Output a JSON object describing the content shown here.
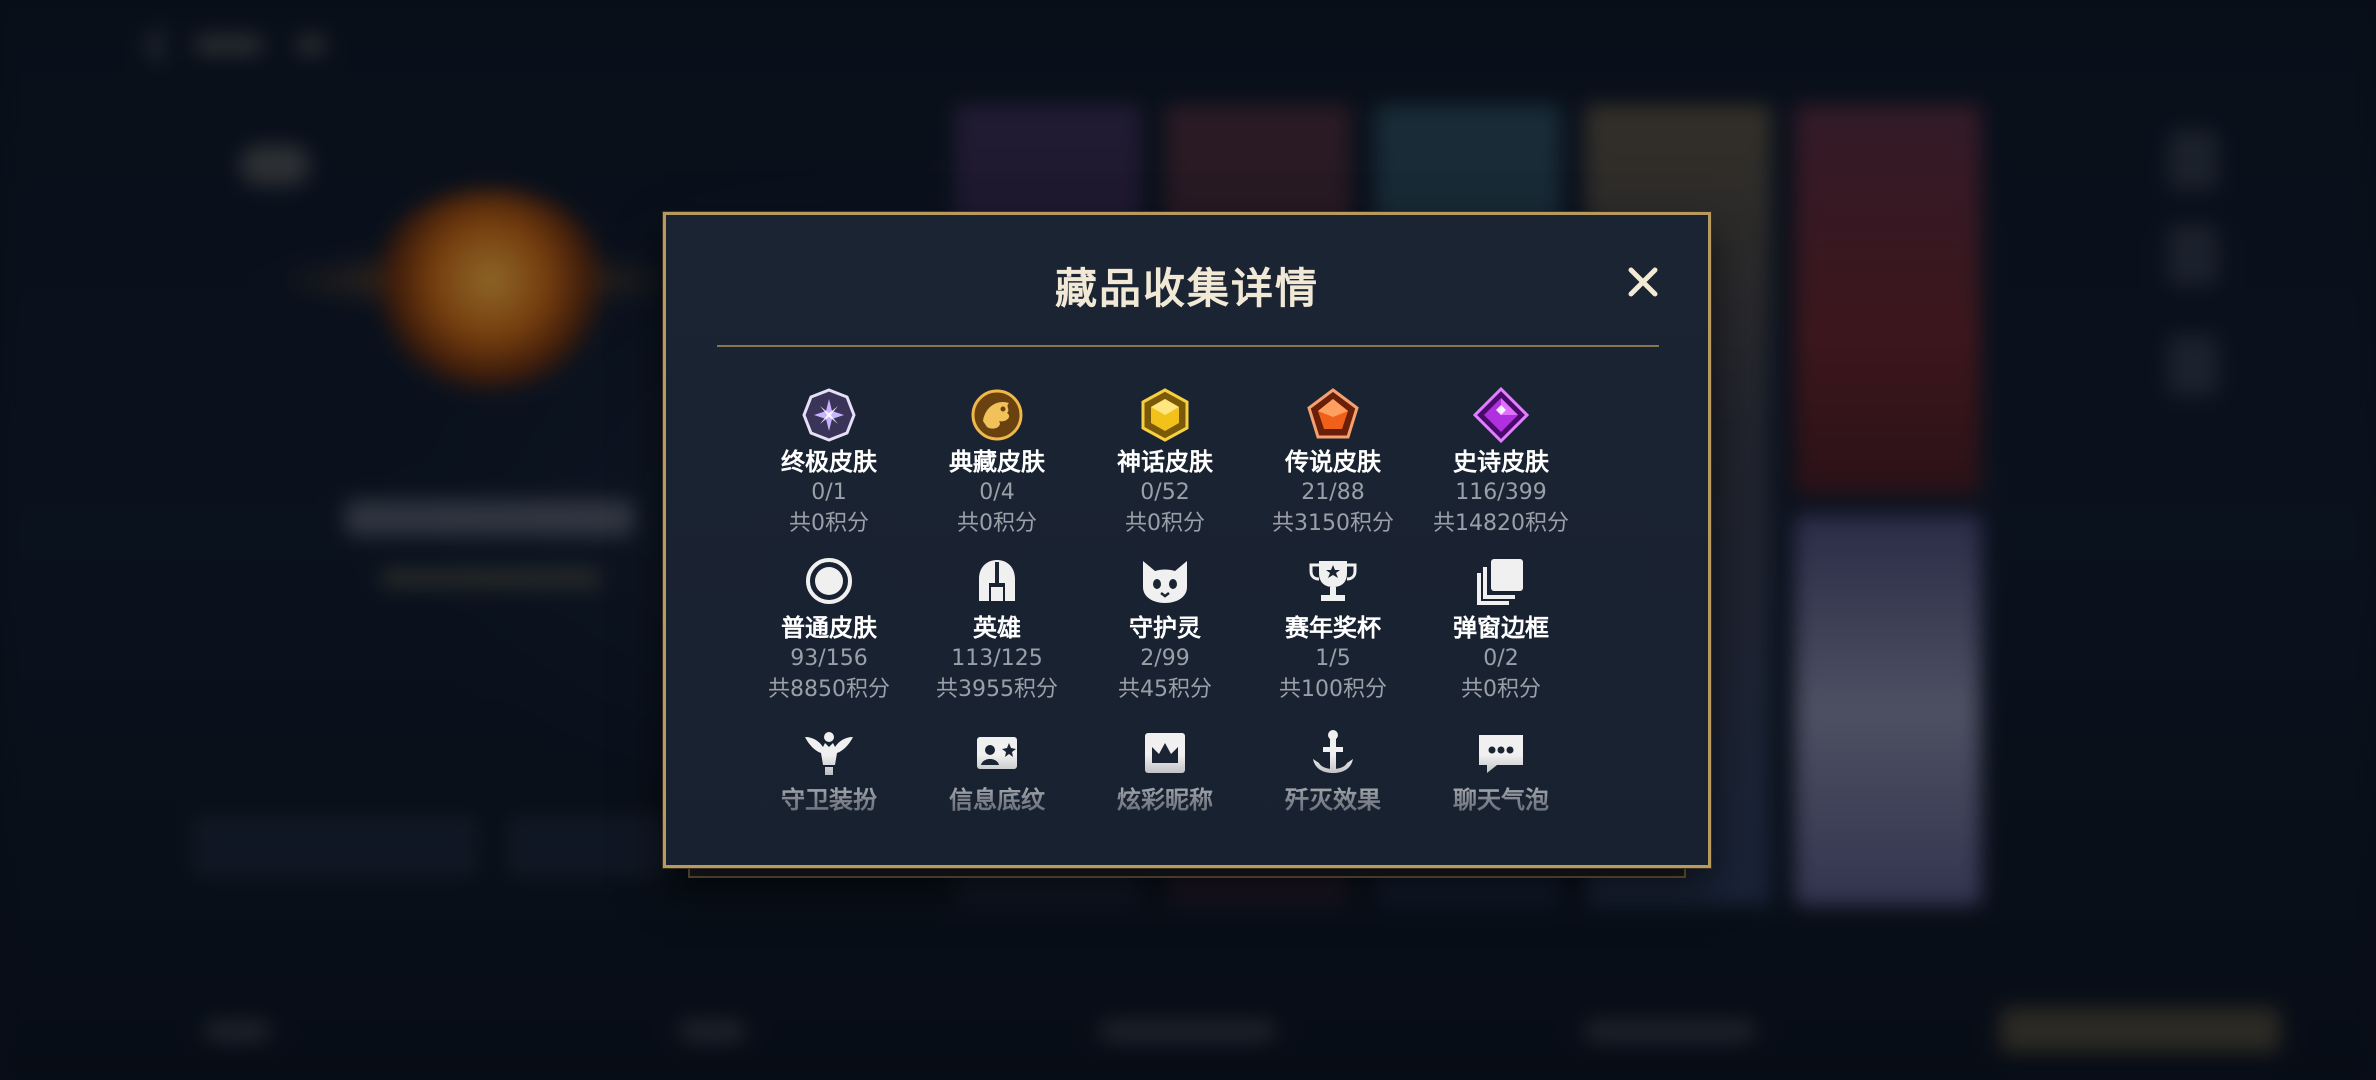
{
  "modal": {
    "title": "藏品收集详情",
    "close_icon": "close-icon"
  },
  "categories": [
    {
      "name": "终极皮肤",
      "count": "0/1",
      "points": "共0积分",
      "icon": "ultimate-skin-icon",
      "color": "#c9b3ff"
    },
    {
      "name": "典藏皮肤",
      "count": "0/4",
      "points": "共0积分",
      "icon": "collection-skin-icon",
      "color": "#e0a430"
    },
    {
      "name": "神话皮肤",
      "count": "0/52",
      "points": "共0积分",
      "icon": "mythic-skin-icon",
      "color": "#f2c21a"
    },
    {
      "name": "传说皮肤",
      "count": "21/88",
      "points": "共3150积分",
      "icon": "legend-skin-icon",
      "color": "#f0601a"
    },
    {
      "name": "史诗皮肤",
      "count": "116/399",
      "points": "共14820积分",
      "icon": "epic-skin-icon",
      "color": "#b030e0"
    },
    {
      "name": "普通皮肤",
      "count": "93/156",
      "points": "共8850积分",
      "icon": "normal-skin-icon",
      "color": "#e8e8e8"
    },
    {
      "name": "英雄",
      "count": "113/125",
      "points": "共3955积分",
      "icon": "hero-helmet-icon",
      "color": "#e8e8e8"
    },
    {
      "name": "守护灵",
      "count": "2/99",
      "points": "共45积分",
      "icon": "guardian-spirit-icon",
      "color": "#e8e8e8"
    },
    {
      "name": "赛年奖杯",
      "count": "1/5",
      "points": "共100积分",
      "icon": "trophy-icon",
      "color": "#e8e8e8"
    },
    {
      "name": "弹窗边框",
      "count": "0/2",
      "points": "共0积分",
      "icon": "popup-frame-icon",
      "color": "#e8e8e8"
    },
    {
      "name": "守卫装扮",
      "count": "",
      "points": "",
      "icon": "guard-outfit-icon",
      "color": "#e8e8e8"
    },
    {
      "name": "信息底纹",
      "count": "",
      "points": "",
      "icon": "info-background-icon",
      "color": "#e8e8e8"
    },
    {
      "name": "炫彩昵称",
      "count": "",
      "points": "",
      "icon": "colorful-nickname-icon",
      "color": "#e8e8e8"
    },
    {
      "name": "歼灭效果",
      "count": "",
      "points": "",
      "icon": "annihilation-effect-icon",
      "color": "#e8e8e8"
    },
    {
      "name": "聊天气泡",
      "count": "",
      "points": "",
      "icon": "chat-bubble-icon",
      "color": "#e8e8e8"
    }
  ]
}
